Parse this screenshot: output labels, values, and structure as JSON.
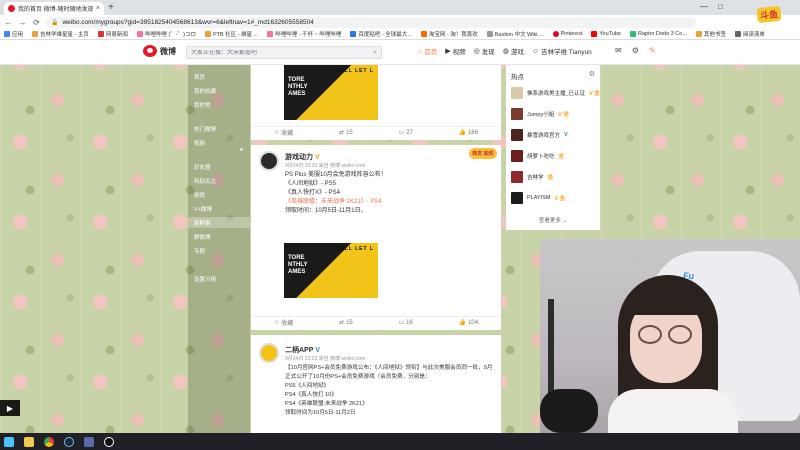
{
  "browser": {
    "tab_title": "我的首页 微博-随时随地发现新鲜事",
    "new_tab": "+",
    "close_tab": "×",
    "url": "weibo.com/mygroups?gid=3951825404568613&wvr=6&leftnav=1#_md1632605558504",
    "nav": {
      "back": "←",
      "forward": "→",
      "reload": "⟳"
    },
    "window_controls": [
      "—",
      "□",
      "×"
    ],
    "bookmarks": [
      "应用",
      "吉林学维星星 - 主页",
      "网易新闻",
      "哔哩哔哩 (゜-゜)つロ",
      "PTB 社区 - 维星 ...",
      "哔哩哔哩 - 干杯 ~ 哔哩哔哩",
      "百度贴吧 - 全球最大...",
      "淘宝网 - 淘！我喜欢",
      "Bastion 中文 Wiki ...",
      "Pinterest",
      "YouTube",
      "Raptor Dodo 3 Co...",
      "其他书签",
      "阅读清单"
    ]
  },
  "weibo": {
    "logo_text": "微博",
    "search_placeholder": "大家正在搜：大宋都管吧",
    "search_icon": "search-icon",
    "nav": [
      {
        "icon": "home-icon",
        "label": "首页",
        "active": true
      },
      {
        "icon": "video-icon",
        "label": "视频",
        "active": false
      },
      {
        "icon": "discover-icon",
        "label": "发现",
        "active": false
      },
      {
        "icon": "game-icon",
        "label": "游戏",
        "active": false
      },
      {
        "icon": "user-icon",
        "label": "吉林学维 Tianyun",
        "active": false
      }
    ],
    "header_icons": [
      "mail-icon",
      "gear-icon",
      "edit-icon"
    ]
  },
  "leftnav": {
    "items": [
      "首页",
      "我的收藏",
      "我的赞",
      "热门微博",
      "视频",
      "好友圈",
      "特别关注",
      "游戏",
      "V+微博",
      "群微博",
      "新鲜事",
      "专题",
      "设置分组"
    ],
    "selected": "新鲜事"
  },
  "feed": {
    "post0": {
      "image_title": "TORE\nNTHLY\nAMES",
      "image_top": "HELL LET L",
      "actions": {
        "favorite": "收藏",
        "repost": "15",
        "comment": "27",
        "like": "166"
      }
    },
    "post1": {
      "user": "游戏动力",
      "badge": "V",
      "meta": "9月24日 23:30 来自 微博 weibo.com",
      "highlight": "转发 抽奖",
      "lines": [
        "PS Plus 美服10月会免游戏阵容公布！",
        "",
        "《人间地狱》- PS5",
        "《真人快打X》- PS4",
        "《英雄联盟：未来战争 2K21》- PS4",
        "",
        "领取时间：10月5日-11月1日。"
      ],
      "image_title": "TORE\nNTHLY\nAMES",
      "image_top": "HELL LET L",
      "actions": {
        "favorite": "收藏",
        "repost": "15",
        "comment": "16",
        "like": "104"
      }
    },
    "post2": {
      "user": "二柄APP",
      "badge": "V",
      "meta": "9月24日 23:33 来自 微博 weibo.com",
      "lines": [
        "【10月官网PS+会员免费游戏公布：《人间地狱》领衔】与此次美服会员同一批，9月",
        "正式公开了10月份PS+会员免费游戏（会员免费，分别是：",
        "PS5《人间地狱》",
        "PS4《真人快打 10》",
        "PS4《英雄联盟:未来战争 2K21》",
        "领取时间为10月5日-11月2日"
      ]
    }
  },
  "hot_users": {
    "title": "热点",
    "gear_icon": "gear-icon",
    "users": [
      {
        "name": "佛系游戏男主播_已认证",
        "badges": "V 坐",
        "color": "#d8c9a9"
      },
      {
        "name": "Jumpy小姐",
        "badges": "V 坐",
        "color": "#7a3b2e"
      },
      {
        "name": "暴雪游戏官方",
        "badges": "V",
        "color": "#4b2320"
      },
      {
        "name": "胡萝卜吃吃",
        "badges": "坐",
        "color": "#6a1e1e"
      },
      {
        "name": "吉林学",
        "badges": "坐",
        "color": "#8a2c2c"
      },
      {
        "name": "PLAYISM",
        "badges": "V 坐",
        "color": "#1c1c1c"
      }
    ],
    "more": "查看更多 ⌄"
  },
  "stream_logo": "斗鱼",
  "taskbar_icons": [
    "start-icon",
    "file-explorer-icon",
    "chrome-icon",
    "steam-icon",
    "gamepad-icon",
    "qq-icon"
  ],
  "play_icon": "play-icon"
}
